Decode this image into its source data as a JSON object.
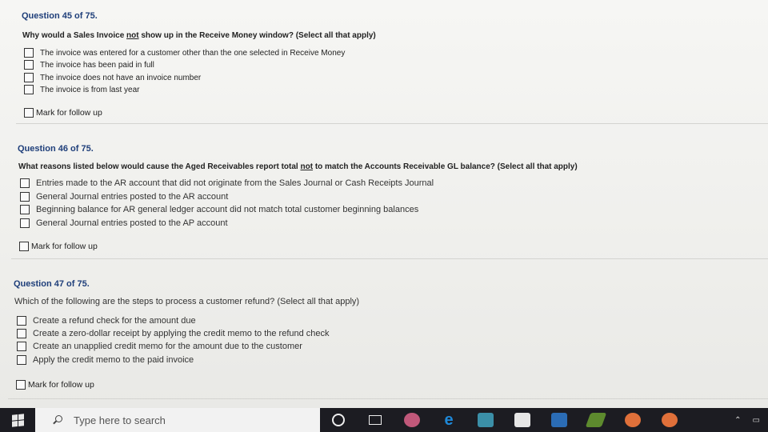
{
  "questions": [
    {
      "title": "Question 45 of 75.",
      "text_before": "Why would a Sales Invoice ",
      "text_underlined": "not",
      "text_after": " show up in the Receive Money window? (Select all that apply)",
      "options": [
        "The invoice was entered for a customer other than the one selected in Receive Money",
        "The invoice has been paid in full",
        "The invoice does not have an invoice number",
        "The invoice is from last year"
      ],
      "mark_label": "Mark for follow up"
    },
    {
      "title": "Question 46 of 75.",
      "text_before": "What reasons listed below would cause the Aged Receivables report total ",
      "text_underlined": "not",
      "text_after": " to match the Accounts Receivable GL balance? (Select all that apply)",
      "options": [
        "Entries made to the AR account that did not originate from the Sales Journal or Cash Receipts Journal",
        "General Journal entries posted to the AR account",
        "Beginning balance for AR general ledger account did not match total customer beginning balances",
        "General Journal entries posted to the AP account"
      ],
      "mark_label": "Mark for follow up"
    },
    {
      "title": "Question 47 of 75.",
      "text": "Which of the following are the steps to process a customer refund? (Select all that apply)",
      "options": [
        "Create a refund check for the amount due",
        "Create a zero-dollar receipt by applying the credit memo to the refund check",
        "Create an unapplied credit memo for the amount due to the customer",
        "Apply the credit memo to the paid invoice"
      ],
      "mark_label": "Mark for follow up"
    }
  ],
  "taskbar": {
    "search_placeholder": "Type here to search",
    "icons": [
      "windows-start-icon",
      "search-icon",
      "cortana-icon",
      "task-view-icon",
      "app-icon",
      "edge-icon",
      "file-explorer-icon",
      "store-icon",
      "word-icon",
      "app-green-icon",
      "app-orange-icon",
      "app-orange2-icon",
      "chevron-up-icon",
      "battery-icon"
    ],
    "accent_colors": {
      "edge": "#1e88d8",
      "word": "#2b6cb5",
      "orange": "#e0703a"
    }
  }
}
